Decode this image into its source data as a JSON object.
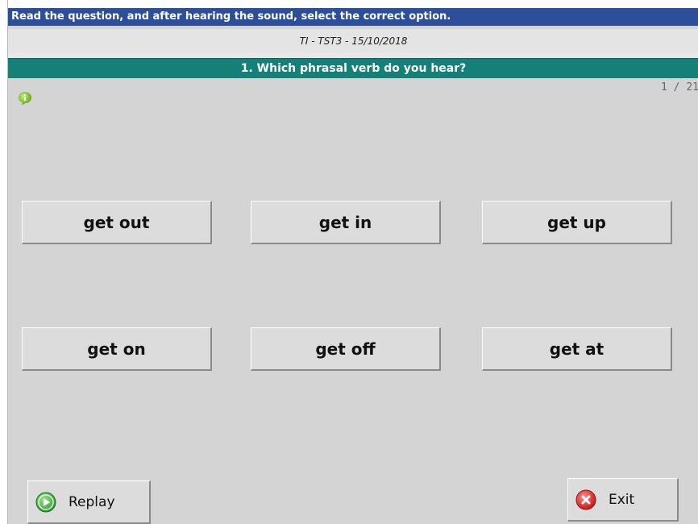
{
  "header": {
    "instruction": "Read the question, and after hearing the sound, select the correct option.",
    "test_id": "TI - TST3 - 15/10/2018",
    "question": "1. Which phrasal verb do you hear?"
  },
  "info_icon": "info-bubble-icon",
  "progress": {
    "label": "1 / 21",
    "current": 1,
    "total": 21
  },
  "options": [
    {
      "label": "get out"
    },
    {
      "label": "get in"
    },
    {
      "label": "get up"
    },
    {
      "label": "get on"
    },
    {
      "label": "get off"
    },
    {
      "label": "get at"
    }
  ],
  "footer": {
    "replay_label": "Replay",
    "replay_icon": "play-circle-icon",
    "exit_label": "Exit",
    "exit_icon": "close-circle-icon"
  },
  "colors": {
    "instruction_bar": "#2d4f9a",
    "question_bar": "#148078",
    "background": "#d4d4d4",
    "replay_icon": "#3cb34a",
    "exit_icon": "#d92b2b"
  }
}
